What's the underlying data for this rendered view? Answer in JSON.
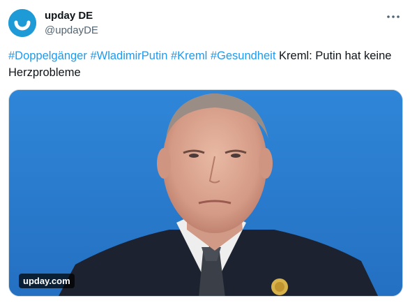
{
  "account": {
    "display_name": "upday DE",
    "handle": "@updayDE",
    "avatar_icon": "smile-logo-icon",
    "avatar_color": "#1e9bd6"
  },
  "tweet": {
    "hashtags": [
      "#Doppelgänger",
      "#WladimirPutin",
      "#Kreml",
      "#Gesundheit"
    ],
    "text": "Kreml: Putin hat keine Herzprobleme",
    "link_color": "#1d9bf0"
  },
  "menu": {
    "icon": "more-horizontal-icon"
  },
  "media": {
    "alt": "",
    "watermark": "upday.com",
    "background_color": "#2a7bd0"
  }
}
